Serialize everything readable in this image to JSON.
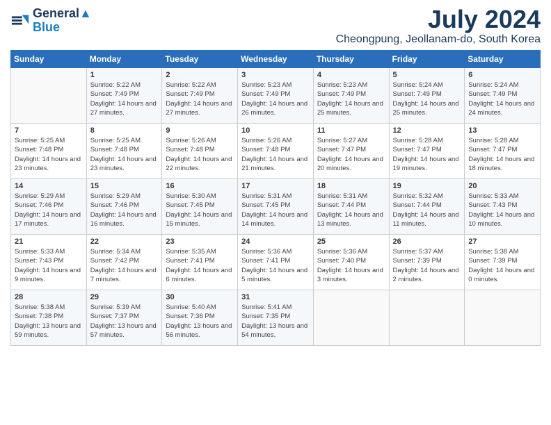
{
  "logo": {
    "line1": "General",
    "line2": "Blue"
  },
  "header": {
    "month": "July 2024",
    "location": "Cheongpung, Jeollanam-do, South Korea"
  },
  "days_of_week": [
    "Sunday",
    "Monday",
    "Tuesday",
    "Wednesday",
    "Thursday",
    "Friday",
    "Saturday"
  ],
  "weeks": [
    [
      {
        "day": "",
        "sunrise": "",
        "sunset": "",
        "daylight": ""
      },
      {
        "day": "1",
        "sunrise": "Sunrise: 5:22 AM",
        "sunset": "Sunset: 7:49 PM",
        "daylight": "Daylight: 14 hours and 27 minutes."
      },
      {
        "day": "2",
        "sunrise": "Sunrise: 5:22 AM",
        "sunset": "Sunset: 7:49 PM",
        "daylight": "Daylight: 14 hours and 27 minutes."
      },
      {
        "day": "3",
        "sunrise": "Sunrise: 5:23 AM",
        "sunset": "Sunset: 7:49 PM",
        "daylight": "Daylight: 14 hours and 26 minutes."
      },
      {
        "day": "4",
        "sunrise": "Sunrise: 5:23 AM",
        "sunset": "Sunset: 7:49 PM",
        "daylight": "Daylight: 14 hours and 25 minutes."
      },
      {
        "day": "5",
        "sunrise": "Sunrise: 5:24 AM",
        "sunset": "Sunset: 7:49 PM",
        "daylight": "Daylight: 14 hours and 25 minutes."
      },
      {
        "day": "6",
        "sunrise": "Sunrise: 5:24 AM",
        "sunset": "Sunset: 7:49 PM",
        "daylight": "Daylight: 14 hours and 24 minutes."
      }
    ],
    [
      {
        "day": "7",
        "sunrise": "Sunrise: 5:25 AM",
        "sunset": "Sunset: 7:48 PM",
        "daylight": "Daylight: 14 hours and 23 minutes."
      },
      {
        "day": "8",
        "sunrise": "Sunrise: 5:25 AM",
        "sunset": "Sunset: 7:48 PM",
        "daylight": "Daylight: 14 hours and 23 minutes."
      },
      {
        "day": "9",
        "sunrise": "Sunrise: 5:26 AM",
        "sunset": "Sunset: 7:48 PM",
        "daylight": "Daylight: 14 hours and 22 minutes."
      },
      {
        "day": "10",
        "sunrise": "Sunrise: 5:26 AM",
        "sunset": "Sunset: 7:48 PM",
        "daylight": "Daylight: 14 hours and 21 minutes."
      },
      {
        "day": "11",
        "sunrise": "Sunrise: 5:27 AM",
        "sunset": "Sunset: 7:47 PM",
        "daylight": "Daylight: 14 hours and 20 minutes."
      },
      {
        "day": "12",
        "sunrise": "Sunrise: 5:28 AM",
        "sunset": "Sunset: 7:47 PM",
        "daylight": "Daylight: 14 hours and 19 minutes."
      },
      {
        "day": "13",
        "sunrise": "Sunrise: 5:28 AM",
        "sunset": "Sunset: 7:47 PM",
        "daylight": "Daylight: 14 hours and 18 minutes."
      }
    ],
    [
      {
        "day": "14",
        "sunrise": "Sunrise: 5:29 AM",
        "sunset": "Sunset: 7:46 PM",
        "daylight": "Daylight: 14 hours and 17 minutes."
      },
      {
        "day": "15",
        "sunrise": "Sunrise: 5:29 AM",
        "sunset": "Sunset: 7:46 PM",
        "daylight": "Daylight: 14 hours and 16 minutes."
      },
      {
        "day": "16",
        "sunrise": "Sunrise: 5:30 AM",
        "sunset": "Sunset: 7:45 PM",
        "daylight": "Daylight: 14 hours and 15 minutes."
      },
      {
        "day": "17",
        "sunrise": "Sunrise: 5:31 AM",
        "sunset": "Sunset: 7:45 PM",
        "daylight": "Daylight: 14 hours and 14 minutes."
      },
      {
        "day": "18",
        "sunrise": "Sunrise: 5:31 AM",
        "sunset": "Sunset: 7:44 PM",
        "daylight": "Daylight: 14 hours and 13 minutes."
      },
      {
        "day": "19",
        "sunrise": "Sunrise: 5:32 AM",
        "sunset": "Sunset: 7:44 PM",
        "daylight": "Daylight: 14 hours and 11 minutes."
      },
      {
        "day": "20",
        "sunrise": "Sunrise: 5:33 AM",
        "sunset": "Sunset: 7:43 PM",
        "daylight": "Daylight: 14 hours and 10 minutes."
      }
    ],
    [
      {
        "day": "21",
        "sunrise": "Sunrise: 5:33 AM",
        "sunset": "Sunset: 7:43 PM",
        "daylight": "Daylight: 14 hours and 9 minutes."
      },
      {
        "day": "22",
        "sunrise": "Sunrise: 5:34 AM",
        "sunset": "Sunset: 7:42 PM",
        "daylight": "Daylight: 14 hours and 7 minutes."
      },
      {
        "day": "23",
        "sunrise": "Sunrise: 5:35 AM",
        "sunset": "Sunset: 7:41 PM",
        "daylight": "Daylight: 14 hours and 6 minutes."
      },
      {
        "day": "24",
        "sunrise": "Sunrise: 5:36 AM",
        "sunset": "Sunset: 7:41 PM",
        "daylight": "Daylight: 14 hours and 5 minutes."
      },
      {
        "day": "25",
        "sunrise": "Sunrise: 5:36 AM",
        "sunset": "Sunset: 7:40 PM",
        "daylight": "Daylight: 14 hours and 3 minutes."
      },
      {
        "day": "26",
        "sunrise": "Sunrise: 5:37 AM",
        "sunset": "Sunset: 7:39 PM",
        "daylight": "Daylight: 14 hours and 2 minutes."
      },
      {
        "day": "27",
        "sunrise": "Sunrise: 5:38 AM",
        "sunset": "Sunset: 7:39 PM",
        "daylight": "Daylight: 14 hours and 0 minutes."
      }
    ],
    [
      {
        "day": "28",
        "sunrise": "Sunrise: 5:38 AM",
        "sunset": "Sunset: 7:38 PM",
        "daylight": "Daylight: 13 hours and 59 minutes."
      },
      {
        "day": "29",
        "sunrise": "Sunrise: 5:39 AM",
        "sunset": "Sunset: 7:37 PM",
        "daylight": "Daylight: 13 hours and 57 minutes."
      },
      {
        "day": "30",
        "sunrise": "Sunrise: 5:40 AM",
        "sunset": "Sunset: 7:36 PM",
        "daylight": "Daylight: 13 hours and 56 minutes."
      },
      {
        "day": "31",
        "sunrise": "Sunrise: 5:41 AM",
        "sunset": "Sunset: 7:35 PM",
        "daylight": "Daylight: 13 hours and 54 minutes."
      },
      {
        "day": "",
        "sunrise": "",
        "sunset": "",
        "daylight": ""
      },
      {
        "day": "",
        "sunrise": "",
        "sunset": "",
        "daylight": ""
      },
      {
        "day": "",
        "sunrise": "",
        "sunset": "",
        "daylight": ""
      }
    ]
  ]
}
